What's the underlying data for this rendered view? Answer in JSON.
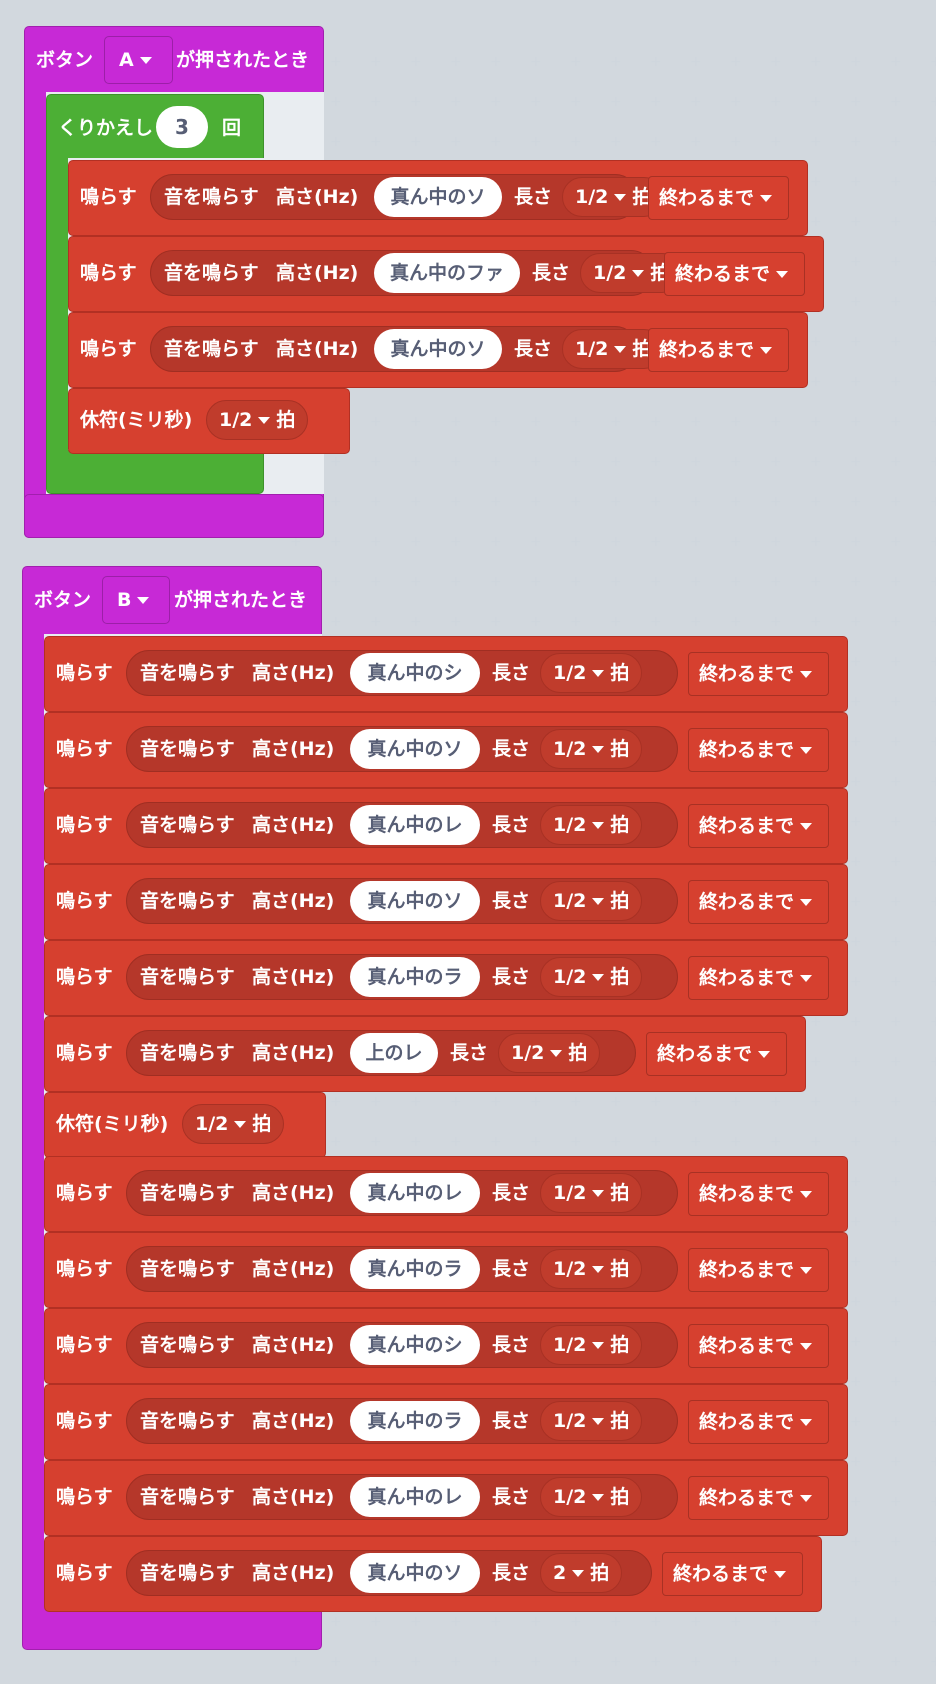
{
  "palette": {
    "event": "#c729d6",
    "loop": "#4caf35",
    "music": "#d6402f",
    "background": "#e9edf1"
  },
  "eventA": {
    "prefix": "ボタン",
    "button": "A",
    "suffix": "が押されたとき"
  },
  "loop": {
    "label": "くりかえし",
    "count": "3",
    "suffix": "回"
  },
  "eventB": {
    "prefix": "ボタン",
    "button": "B",
    "suffix": "が押されたとき"
  },
  "play": {
    "label": "鳴らす",
    "inner": "音を鳴らす",
    "pitch": "高さ(Hz)",
    "length": "長さ",
    "beat_unit": "拍",
    "until": "終わるまで"
  },
  "rest": {
    "label": "休符(ミリ秒)",
    "beat": "1/2",
    "beat_unit": "拍"
  },
  "a_notes": [
    {
      "note": "真ん中のソ",
      "beat": "1/2"
    },
    {
      "note": "真ん中のファ",
      "beat": "1/2"
    },
    {
      "note": "真ん中のソ",
      "beat": "1/2"
    }
  ],
  "b_notes_1": [
    {
      "note": "真ん中のシ",
      "beat": "1/2"
    },
    {
      "note": "真ん中のソ",
      "beat": "1/2"
    },
    {
      "note": "真ん中のレ",
      "beat": "1/2"
    },
    {
      "note": "真ん中のソ",
      "beat": "1/2"
    },
    {
      "note": "真ん中のラ",
      "beat": "1/2"
    },
    {
      "note": "上のレ",
      "beat": "1/2"
    }
  ],
  "b_notes_2": [
    {
      "note": "真ん中のレ",
      "beat": "1/2"
    },
    {
      "note": "真ん中のラ",
      "beat": "1/2"
    },
    {
      "note": "真ん中のシ",
      "beat": "1/2"
    },
    {
      "note": "真ん中のラ",
      "beat": "1/2"
    },
    {
      "note": "真ん中のレ",
      "beat": "1/2"
    },
    {
      "note": "真ん中のソ",
      "beat": "2"
    }
  ]
}
